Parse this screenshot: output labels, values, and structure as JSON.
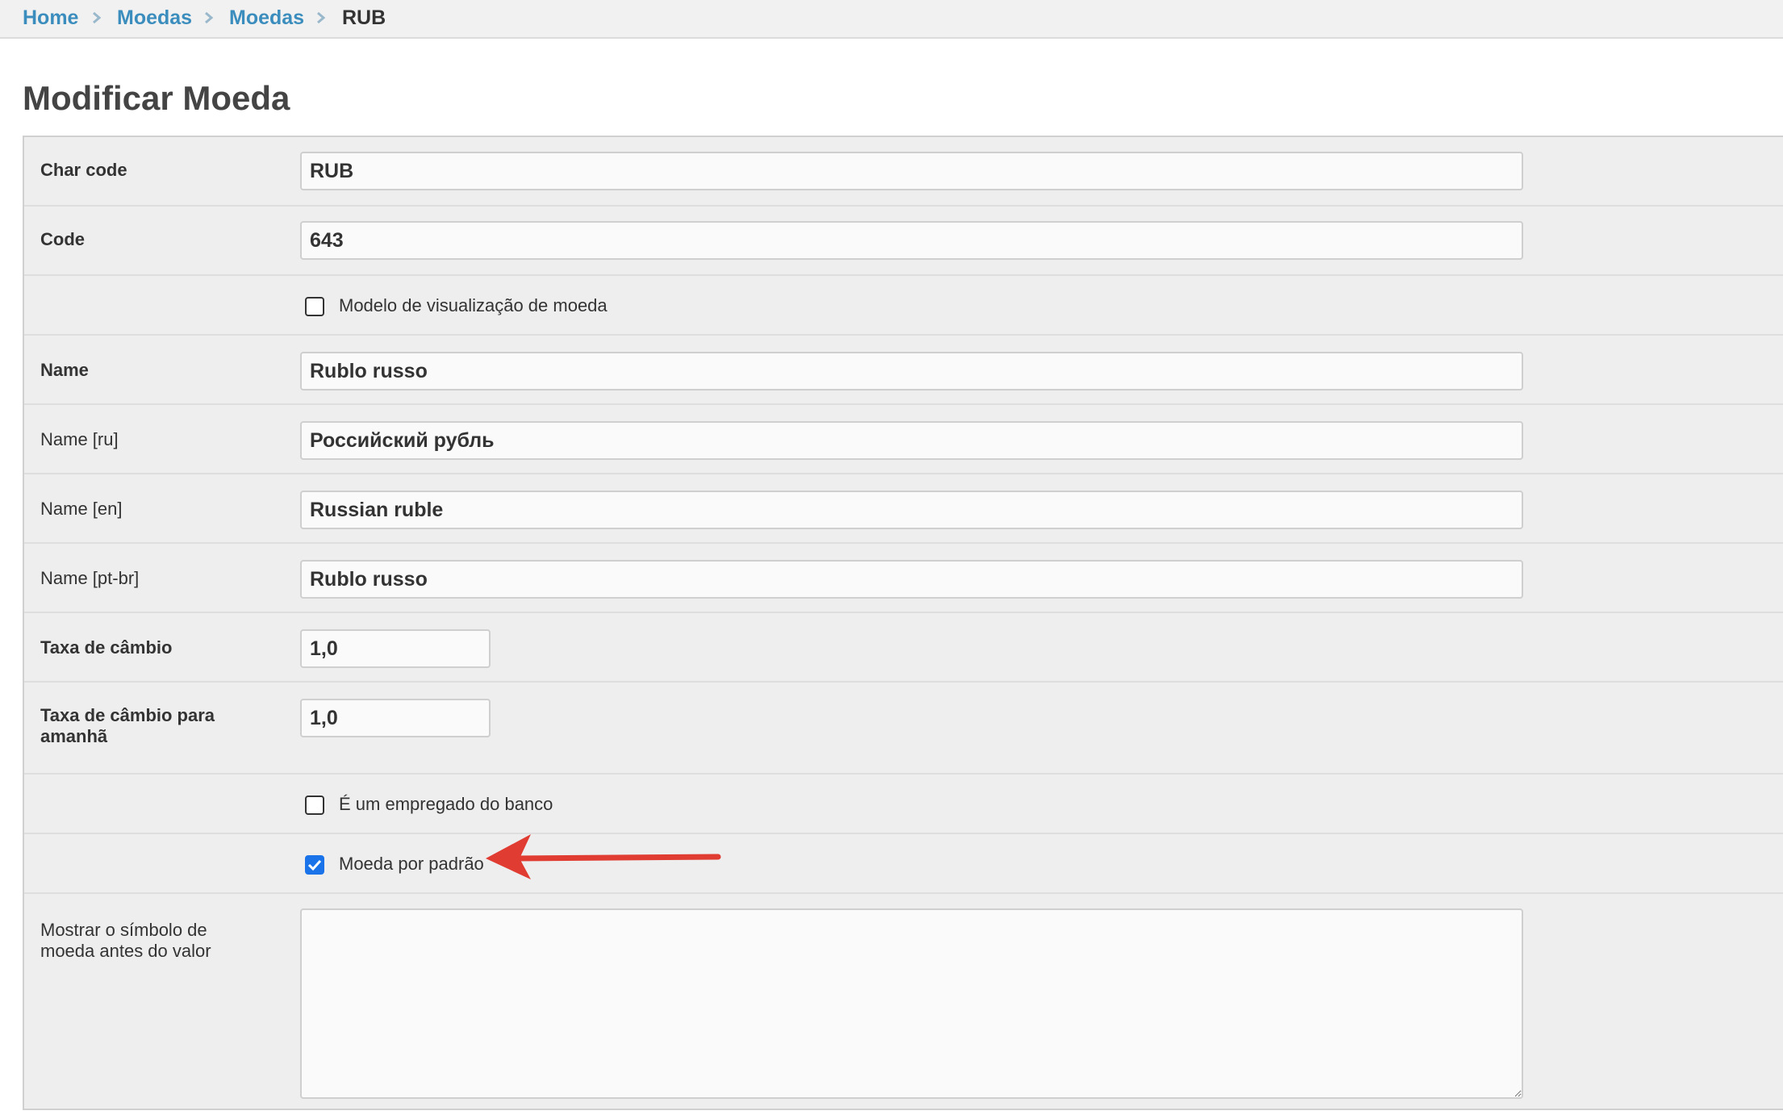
{
  "breadcrumb": {
    "items": [
      {
        "label": "Home"
      },
      {
        "label": "Moedas"
      },
      {
        "label": "Moedas"
      }
    ],
    "current": "RUB"
  },
  "page": {
    "title": "Modificar Moeda"
  },
  "form": {
    "char_code": {
      "label": "Char code",
      "value": "RUB"
    },
    "code": {
      "label": "Code",
      "value": "643"
    },
    "display_template": {
      "label": "Modelo de visualização de moeda",
      "checked": false
    },
    "name": {
      "label": "Name",
      "value": "Rublo russo"
    },
    "name_ru": {
      "label": "Name [ru]",
      "value": "Российский рубль"
    },
    "name_en": {
      "label": "Name [en]",
      "value": "Russian ruble"
    },
    "name_ptbr": {
      "label": "Name [pt-br]",
      "value": "Rublo russo"
    },
    "rate": {
      "label": "Taxa de câmbio",
      "value": "1,0"
    },
    "rate_tomorrow": {
      "label": "Taxa de câmbio para amanhã",
      "value": "1,0"
    },
    "bank_employee": {
      "label": "É um empregado do banco",
      "checked": false
    },
    "default_currency": {
      "label": "Moeda por padrão",
      "checked": true
    },
    "symbol_before": {
      "label": "Mostrar o símbolo de moeda antes do valor",
      "value": ""
    }
  },
  "annotation": {
    "arrow_color": "#e03c31"
  },
  "colors": {
    "link": "#3b8dbd",
    "checkbox_checked": "#1a73e8",
    "panel_background": "#eeeeee"
  }
}
